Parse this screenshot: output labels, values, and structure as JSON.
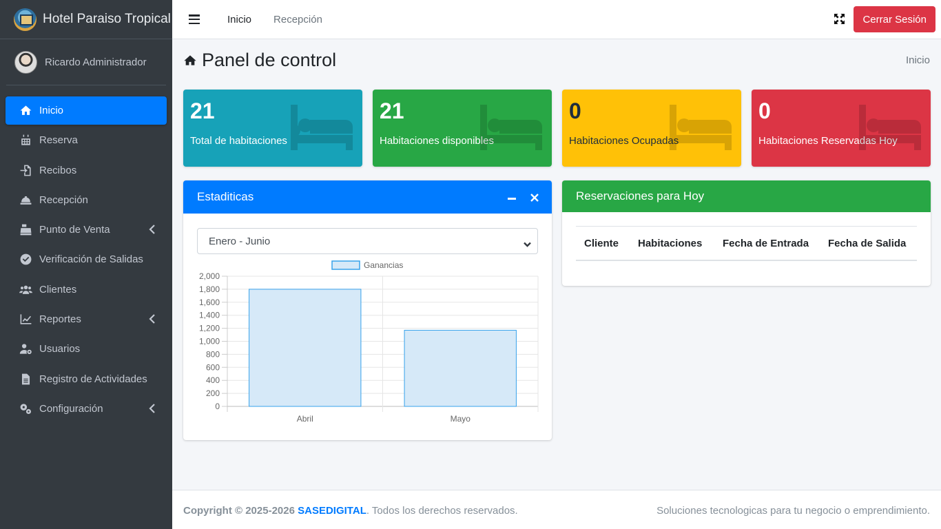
{
  "sidebar": {
    "brand": "Hotel Paraiso Tropical",
    "user": "Ricardo Administrador",
    "items": [
      {
        "label": "Inicio",
        "icon": "home-icon",
        "active": true
      },
      {
        "label": "Reserva",
        "icon": "calendar-icon"
      },
      {
        "label": "Recibos",
        "icon": "file-import-icon"
      },
      {
        "label": "Recepción",
        "icon": "concierge-bell-icon"
      },
      {
        "label": "Punto de Venta",
        "icon": "cash-register-icon",
        "has_submenu": true
      },
      {
        "label": "Verificación de Salidas",
        "icon": "check-circle-icon"
      },
      {
        "label": "Clientes",
        "icon": "users-icon"
      },
      {
        "label": "Reportes",
        "icon": "chart-line-icon",
        "has_submenu": true
      },
      {
        "label": "Usuarios",
        "icon": "user-cog-icon"
      },
      {
        "label": "Registro de Actividades",
        "icon": "file-alt-icon"
      },
      {
        "label": "Configuración",
        "icon": "cogs-icon",
        "has_submenu": true
      }
    ]
  },
  "topbar": {
    "links": [
      "Inicio",
      "Recepción"
    ],
    "logout_label": "Cerrar Sesión"
  },
  "header": {
    "title": "Panel de control",
    "breadcrumb": "Inicio"
  },
  "info_boxes": [
    {
      "value": "21",
      "label": "Total de habitaciones",
      "color": "#17a2b8"
    },
    {
      "value": "21",
      "label": "Habitaciones disponibles",
      "color": "#28a745"
    },
    {
      "value": "0",
      "label": "Habitaciones Ocupadas",
      "color": "#ffc107"
    },
    {
      "value": "0",
      "label": "Habitaciones Reservadas Hoy",
      "color": "#dc3545"
    }
  ],
  "stats_card": {
    "title": "Estaditicas",
    "select_value": "Enero - Junio"
  },
  "reservations_card": {
    "title": "Reservaciones para Hoy",
    "columns": [
      "Cliente",
      "Habitaciones",
      "Fecha de Entrada",
      "Fecha de Salida"
    ]
  },
  "chart_data": {
    "type": "bar",
    "categories": [
      "Abril",
      "Mayo"
    ],
    "series": [
      {
        "name": "Ganancias",
        "values": [
          1800,
          1170
        ]
      }
    ],
    "ylim": [
      0,
      2000
    ],
    "yticks": [
      0,
      200,
      400,
      600,
      800,
      1000,
      1200,
      1400,
      1600,
      1800,
      2000
    ],
    "ytick_labels": [
      "0",
      "200",
      "400",
      "600",
      "800",
      "1,000",
      "1,200",
      "1,400",
      "1,600",
      "1,800",
      "2,000"
    ],
    "grid": true,
    "legend": "top",
    "colors": {
      "fill": "#d6e9f8",
      "stroke": "#36a2eb"
    }
  },
  "footer": {
    "copyright": "Copyright © 2025-2026",
    "company": "SASEDIGITAL",
    "rights": ". Todos los derechos reservados.",
    "tagline": "Soluciones tecnologicas para tu negocio o emprendimiento."
  },
  "colors": {
    "sidebar_bg": "#343a40",
    "primary": "#007bff",
    "danger": "#dc3545"
  }
}
